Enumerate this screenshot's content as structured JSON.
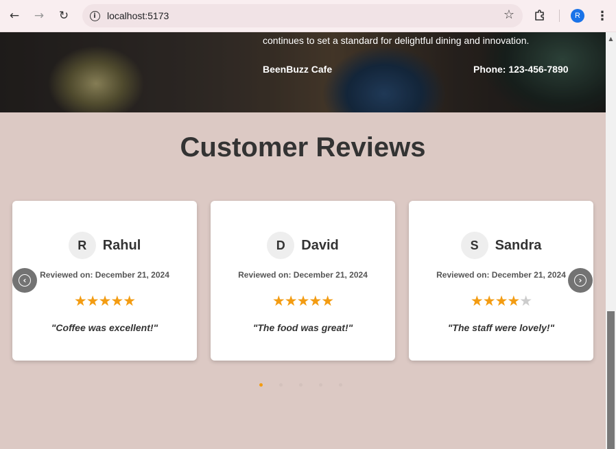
{
  "browser": {
    "url": "localhost:5173",
    "profile_initial": "R",
    "icons": {
      "back": "arrow-left-icon",
      "forward": "arrow-right-icon",
      "reload": "reload-icon",
      "site_info": "info-icon",
      "bookmark": "star-outline-icon",
      "extensions": "puzzle-icon",
      "menu": "kebab-menu-icon"
    }
  },
  "hero": {
    "tagline": "continues to set a standard for delightful dining and innovation.",
    "brand": "BeenBuzz Cafe",
    "phone": "Phone: 123-456-7890"
  },
  "reviews": {
    "title": "Customer Reviews",
    "star_color": "#f39c12",
    "items": [
      {
        "initial": "R",
        "name": "Rahul",
        "date": "Reviewed on: December 21, 2024",
        "rating": 5,
        "max_rating": 5,
        "text": "\"Coffee was excellent!\""
      },
      {
        "initial": "D",
        "name": "David",
        "date": "Reviewed on: December 21, 2024",
        "rating": 5,
        "max_rating": 5,
        "text": "\"The food was great!\""
      },
      {
        "initial": "S",
        "name": "Sandra",
        "date": "Reviewed on: December 21, 2024",
        "rating": 4,
        "max_rating": 5,
        "text": "\"The staff were lovely!\""
      }
    ],
    "carousel": {
      "prev_icon": "chevron-left-icon",
      "next_icon": "chevron-right-icon",
      "page_count": 5,
      "active_page": 1
    }
  }
}
